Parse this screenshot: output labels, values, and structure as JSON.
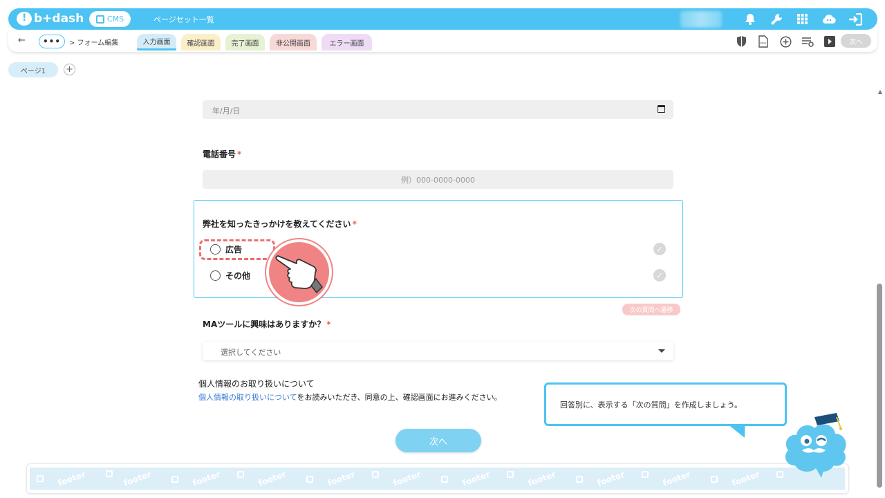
{
  "topbar": {
    "brand": "b+dash",
    "cms_label": "CMS",
    "pageset_label": "ページセット一覧",
    "icons": [
      "bell-icon",
      "wrench-icon",
      "grid-icon",
      "cloud-chat-icon",
      "logout-icon"
    ]
  },
  "subbar": {
    "back_icon": "arrow-left-icon",
    "more_label": "•••",
    "breadcrumb": "> フォーム編集",
    "tabs": [
      {
        "label": "入力画面",
        "color": "#d4ecf8",
        "active": true
      },
      {
        "label": "確認画面",
        "color": "#fbefc9",
        "active": false
      },
      {
        "label": "完了画面",
        "color": "#e6f2d3",
        "active": false
      },
      {
        "label": "非公開画面",
        "color": "#f9d8d8",
        "active": false
      },
      {
        "label": "エラー画面",
        "color": "#eedcf6",
        "active": false
      }
    ],
    "right_icons": [
      "shield-icon",
      "html-file-icon",
      "plus-circle-icon",
      "list-settings-icon",
      "play-icon"
    ],
    "next_label": "次へ"
  },
  "pages": {
    "tab_label": "ページ1",
    "add_label": "+"
  },
  "form": {
    "date_placeholder": "年/月/日",
    "phone_label": "電話番号",
    "phone_placeholder": "例）000-0000-0000",
    "question_label": "弊社を知ったきっかけを教えてください",
    "options": [
      "広告",
      "その他"
    ],
    "check_glyph": "✓",
    "transition_badge": "次の質問へ遷移",
    "ma_label": "MAツールに興味はありますか？",
    "select_placeholder": "選択してください",
    "required_mark": "*",
    "privacy_title": "個人情報のお取り扱いについて",
    "privacy_link": "個人情報の取り扱いについて",
    "privacy_text": "をお読みいただき、同意の上、確認画面にお進みください。",
    "next_button": "次へ"
  },
  "footer": {
    "watermark": "footer"
  },
  "tip": {
    "text": "回答別に、表示する「次の質問」を作成しましょう。"
  },
  "colors": {
    "accent": "#4cc3f2",
    "required": "#e45f5f",
    "pointer": "#f08484",
    "link": "#3a7bd5"
  }
}
